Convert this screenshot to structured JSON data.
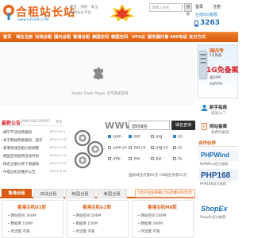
{
  "header": {
    "logo_text": "合租站长站",
    "logo_url_text": "www.HZH28.COM",
    "slogan_line1": "稳定 · 快捷 · 安全",
    "slogan_line2": "合租站长平台",
    "top_search_placeholder": "请输入域名",
    "top_search_button": "搜索",
    "login_link": "登录",
    "register_link": "注册",
    "qq_link": "在线QQ客服",
    "phone": "3263"
  },
  "nav": {
    "items": [
      "首页",
      "域名注册",
      "双线合租",
      "国内合租",
      "香港合租",
      "美国空间",
      "韩国空间",
      "VPS云",
      "服务器托管",
      "400电话",
      "支付方式"
    ]
  },
  "banner": {
    "flash_text": "Adobe Flash Player 已不再受支持"
  },
  "right": {
    "ad_title": "国内专",
    "ad_line1": "1G免备",
    "ad_big": "1G免备案",
    "ad_line2": "送20M",
    "ad_line3": "ASP/PH",
    "guide_title": "新手指南",
    "guide_sub": "快速入门",
    "service_title": "网站备案",
    "service_sub": "免费代备案",
    "partner_title": "合作伙伴",
    "partners": [
      {
        "name": "PHPWind",
        "caption": "PHPWind官方推荐"
      },
      {
        "name": "PHP168",
        "caption": "PHP168官方推荐"
      },
      {
        "name": "ShopEx",
        "caption": "ShopEx官方推荐"
      }
    ]
  },
  "news": {
    "title": "最新公告",
    "subtitle": "ANNOUNCEMENT",
    "more": "更多",
    "items": [
      {
        "text": "端午节活动预通知",
        "date": "2011-6-1"
      },
      {
        "text": "关于网站改版通知，提示",
        "date": "2011-5-28"
      },
      {
        "text": "香港双线合租价格调整",
        "date": "2011-5-20"
      },
      {
        "text": "韩国空间促销活动开始",
        "date": "2011-5-12"
      },
      {
        "text": "域名注册价格下调通知",
        "date": "2011-5-05"
      },
      {
        "text": "中电信机房维护公告",
        "date": "2011-4-28"
      }
    ]
  },
  "domain": {
    "www_label": "WWW.",
    "input_placeholder": "您的域名",
    "button": "域名查询",
    "tlds": [
      {
        "label": ".com",
        "checked": true
      },
      {
        "label": ".net",
        "checked": true
      },
      {
        "label": ".org",
        "checked": false
      },
      {
        "label": ".cn",
        "checked": true
      },
      {
        "label": ".com.cn",
        "checked": false
      },
      {
        "label": ".net.cn",
        "checked": false
      },
      {
        "label": ".org.cn",
        "checked": false
      },
      {
        "label": ".cc",
        "checked": false
      },
      {
        "label": ".info",
        "checked": false
      },
      {
        "label": ".me",
        "checked": false
      },
      {
        "label": ".biz",
        "checked": false
      },
      {
        "label": ".tv",
        "checked": false
      }
    ],
    "note": "国际域名仅需65元 CN域名仅需35元"
  },
  "hosting": {
    "tabs": [
      "香港合租",
      "双线合租",
      "韩国合租",
      "美国合租"
    ],
    "promo": "5元产企业邮箱1.5G优惠240元/年",
    "cards": [
      {
        "title": "香港主机D1型",
        "lines": [
          "网站空间 300M",
          "数据库 150M",
          "月流量 不限"
        ]
      },
      {
        "title": "香港主机G1型",
        "lines": [
          "网站空间 500M",
          "数据库 150M",
          "月流量 不限"
        ]
      },
      {
        "title": "香港主机M8型",
        "lines": [
          "网站空间 500M",
          "数据库 200M",
          "月流量 不限"
        ]
      }
    ]
  },
  "colors": {
    "brand_orange": "#d95b11",
    "brand_blue": "#2c86c8",
    "accent_red": "#d6202b"
  }
}
